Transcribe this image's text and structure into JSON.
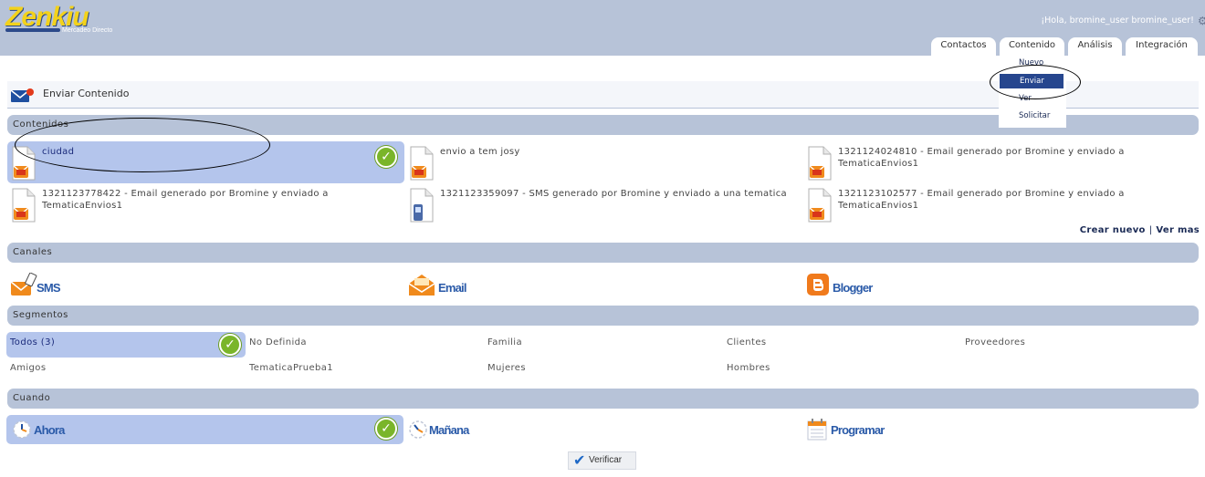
{
  "app": {
    "logo_text": "Zenkiu",
    "logo_subtitle": "Mercadeo Directo",
    "greeting": "¡Hola, bromine_user bromine_user!"
  },
  "tabs": [
    {
      "label": "Contactos"
    },
    {
      "label": "Contenido"
    },
    {
      "label": "Análisis"
    },
    {
      "label": "Integración"
    }
  ],
  "dropdown": {
    "items": [
      {
        "label": "Nuevo"
      },
      {
        "label": "Enviar"
      },
      {
        "label": "Ver"
      },
      {
        "label": "Solicitar"
      }
    ]
  },
  "page": {
    "title": "Enviar Contenido"
  },
  "sections": {
    "contenidos": "Contenidos",
    "canales": "Canales",
    "segmentos": "Segmentos",
    "cuando": "Cuando"
  },
  "contents": [
    {
      "label": "ciudad",
      "type": "email"
    },
    {
      "label": "envio a tem josy",
      "type": "email"
    },
    {
      "label": "1321124024810 - Email generado por Bromine y enviado a TematicaEnvios1",
      "type": "email"
    },
    {
      "label": "1321123778422 - Email generado por Bromine y enviado a TematicaEnvios1",
      "type": "email"
    },
    {
      "label": "1321123359097 - SMS generado por Bromine y enviado a una tematica",
      "type": "sms"
    },
    {
      "label": "1321123102577 - Email generado por Bromine y enviado a TematicaEnvios1",
      "type": "email"
    }
  ],
  "content_links": {
    "create": "Crear nuevo",
    "separator": "|",
    "more": "Ver mas"
  },
  "channels": [
    {
      "label": "SMS",
      "icon": "sms-icon"
    },
    {
      "label": "Email",
      "icon": "email-icon"
    },
    {
      "label": "Blogger",
      "icon": "blogger-icon"
    }
  ],
  "segments": [
    {
      "label": "Todos (3)"
    },
    {
      "label": "No Definida"
    },
    {
      "label": "Familia"
    },
    {
      "label": "Clientes"
    },
    {
      "label": "Proveedores"
    },
    {
      "label": "Amigos"
    },
    {
      "label": "TematicaPrueba1"
    },
    {
      "label": "Mujeres"
    },
    {
      "label": "Hombres"
    }
  ],
  "when": [
    {
      "label": "Ahora",
      "icon": "clock-icon"
    },
    {
      "label": "Mañana",
      "icon": "clock-icon"
    },
    {
      "label": "Programar",
      "icon": "calendar-icon"
    }
  ],
  "verify_label": "Verificar",
  "colors": {
    "header": "#b7c3d8",
    "selected": "#b4c5ec",
    "accent": "#26468e",
    "check": "#7ab52a",
    "link": "#2a5aa8"
  }
}
